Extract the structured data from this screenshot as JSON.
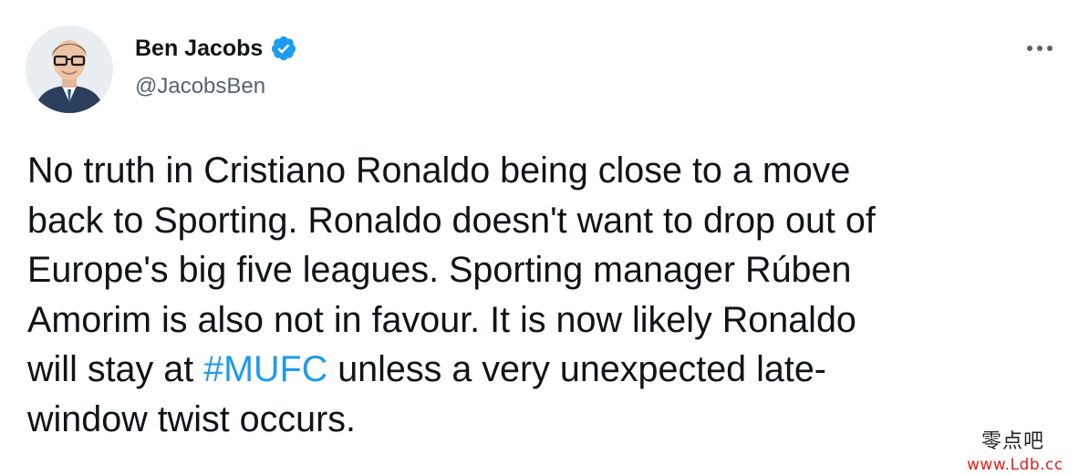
{
  "author": {
    "display_name": "Ben Jacobs",
    "handle": "@JacobsBen",
    "verified": true
  },
  "more_icon": "more-horizontal-icon",
  "tweet": {
    "lines": [
      {
        "before": "No truth in Cristiano Ronaldo being close to a move",
        "link": "",
        "after": ""
      },
      {
        "before": "back to Sporting. Ronaldo doesn't want to drop out of",
        "link": "",
        "after": ""
      },
      {
        "before": "Europe's big five leagues. Sporting manager Rúben",
        "link": "",
        "after": ""
      },
      {
        "before": "Amorim is also not in favour. It is now likely Ronaldo",
        "link": "",
        "after": ""
      },
      {
        "before": "will stay at ",
        "link": "#MUFC",
        "after": " unless a very unexpected late-"
      },
      {
        "before": "window twist occurs.",
        "link": "",
        "after": ""
      }
    ]
  },
  "colors": {
    "text": "#0f1419",
    "secondary": "#536471",
    "accent": "#1d9bf0",
    "watermark_url": "#e0201c"
  },
  "watermark": {
    "text_cn": "零点吧",
    "url": "www.Ldb.cc"
  }
}
